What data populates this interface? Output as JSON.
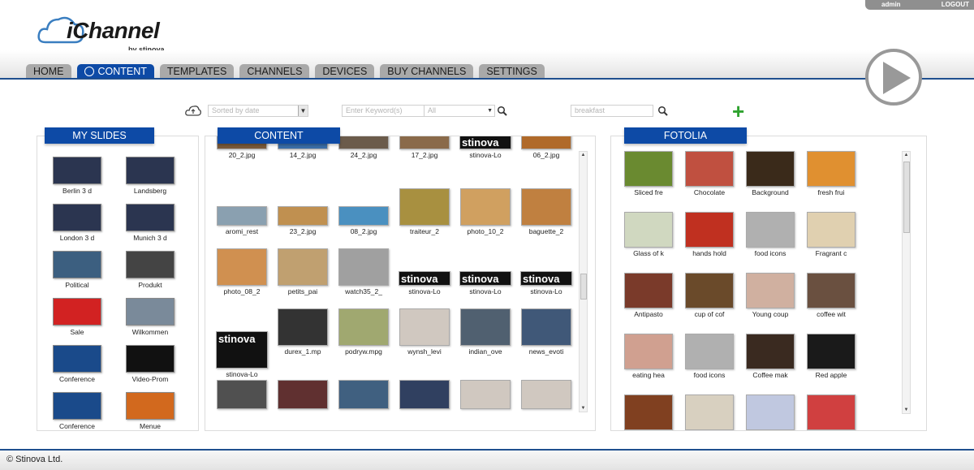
{
  "header": {
    "user": "admin",
    "logout": "LOGOUT",
    "app_name": "iChannel",
    "by_label": "by stinova"
  },
  "nav": {
    "tabs": [
      "HOME",
      "CONTENT",
      "TEMPLATES",
      "CHANNELS",
      "DEVICES",
      "BUY CHANNELS",
      "SETTINGS"
    ],
    "active": "CONTENT"
  },
  "toolbar": {
    "sort_value": "Sorted by date",
    "keyword_placeholder": "Enter Keyword(s)",
    "category_value": "All",
    "search_value": "breakfast"
  },
  "panels": {
    "my_slides": "MY SLIDES",
    "content": "CONTENT",
    "fotolia": "FOTOLIA"
  },
  "my_slides": [
    {
      "label": "Berlin 3 d",
      "color": "#2b3550"
    },
    {
      "label": "Landsberg",
      "color": "#2b3550"
    },
    {
      "label": "London 3 d",
      "color": "#2b3550"
    },
    {
      "label": "Munich 3 d",
      "color": "#2b3550"
    },
    {
      "label": "Political",
      "color": "#3c5f80"
    },
    {
      "label": "Produkt",
      "color": "#444444"
    },
    {
      "label": "Sale",
      "color": "#d22222"
    },
    {
      "label": "Wilkommen",
      "color": "#7a8a9a"
    },
    {
      "label": "Conference",
      "color": "#1a4a8a"
    },
    {
      "label": "Video-Prom",
      "color": "#111111"
    },
    {
      "label": "Conference",
      "color": "#1a4a8a"
    },
    {
      "label": "Menue",
      "color": "#d2691e"
    }
  ],
  "content_items": [
    {
      "label": "20_2.jpg",
      "color": "#7a5a3a"
    },
    {
      "label": "14_2.jpg",
      "color": "#3a6ea8"
    },
    {
      "label": "24_2.jpg",
      "color": "#6b5b4b"
    },
    {
      "label": "17_2.jpg",
      "color": "#8a6a4a"
    },
    {
      "label": "stinova-Lo",
      "color": "#111111",
      "stinova": true
    },
    {
      "label": "06_2.jpg",
      "color": "#b06a2a"
    },
    {
      "label": "aromi_rest",
      "color": "#8aa0b0"
    },
    {
      "label": "23_2.jpg",
      "color": "#c09050"
    },
    {
      "label": "08_2.jpg",
      "color": "#4a90c0"
    },
    {
      "label": "traiteur_2",
      "color": "#a89040"
    },
    {
      "label": "photo_10_2",
      "color": "#d0a060"
    },
    {
      "label": "baguette_2",
      "color": "#c08040"
    },
    {
      "label": "photo_08_2",
      "color": "#d09050"
    },
    {
      "label": "petits_pai",
      "color": "#c0a070"
    },
    {
      "label": "watch35_2_",
      "color": "#a0a0a0"
    },
    {
      "label": "stinova-Lo",
      "color": "#111111",
      "stinova": true
    },
    {
      "label": "stinova-Lo",
      "color": "#111111",
      "stinova": true
    },
    {
      "label": "stinova-Lo",
      "color": "#111111",
      "stinova": true
    },
    {
      "label": "stinova-Lo",
      "color": "#111111",
      "stinova": true
    },
    {
      "label": "durex_1.mp",
      "color": "#333333"
    },
    {
      "label": "podryw.mpg",
      "color": "#a0a870"
    },
    {
      "label": "wynsh_levi",
      "color": "#d0c8c0"
    },
    {
      "label": "indian_ove",
      "color": "#506070"
    },
    {
      "label": "news_evoti",
      "color": "#405878"
    },
    {
      "label": "",
      "color": "#505050"
    },
    {
      "label": "",
      "color": "#603030"
    },
    {
      "label": "",
      "color": "#406080"
    },
    {
      "label": "",
      "color": "#304060"
    },
    {
      "label": "",
      "color": "#d0c8c0"
    },
    {
      "label": "",
      "color": "#d0c8c0"
    }
  ],
  "fotolia_items": [
    {
      "label": "Sliced fre",
      "color": "#6a8a30"
    },
    {
      "label": "Chocolate",
      "color": "#c05040"
    },
    {
      "label": "Background",
      "color": "#3a2a1a"
    },
    {
      "label": "fresh frui",
      "color": "#e09030"
    },
    {
      "label": "Glass of k",
      "color": "#d0d8c0"
    },
    {
      "label": "hands hold",
      "color": "#c03020"
    },
    {
      "label": "food icons",
      "color": "#b0b0b0"
    },
    {
      "label": "Fragrant c",
      "color": "#e0d0b0"
    },
    {
      "label": "Antipasto",
      "color": "#7a3a2a"
    },
    {
      "label": "cup of cof",
      "color": "#6a4a2a"
    },
    {
      "label": "Young coup",
      "color": "#d0b0a0"
    },
    {
      "label": "coffee wit",
      "color": "#6a5040"
    },
    {
      "label": "eating hea",
      "color": "#d0a090"
    },
    {
      "label": "food icons",
      "color": "#b0b0b0"
    },
    {
      "label": "Coffee mak",
      "color": "#3a2a20"
    },
    {
      "label": "Red apple",
      "color": "#1a1a1a"
    },
    {
      "label": "",
      "color": "#804020"
    },
    {
      "label": "",
      "color": "#d8d0c0"
    },
    {
      "label": "",
      "color": "#c0c8e0"
    },
    {
      "label": "",
      "color": "#d04040"
    }
  ],
  "footer": {
    "copyright": "© Stinova Ltd."
  }
}
